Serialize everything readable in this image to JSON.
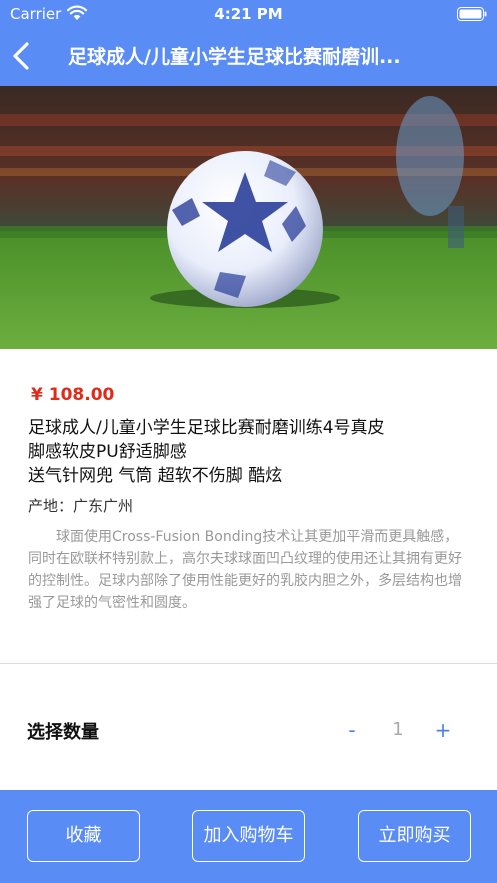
{
  "status_bar": {
    "carrier": "Carrier",
    "time": "4:21 PM"
  },
  "nav": {
    "title": "足球成人/儿童小学生足球比赛耐磨训...",
    "back_icon": "chevron-left-icon",
    "background_color": "#5a8cf6"
  },
  "product": {
    "price": "¥ 108.00",
    "name_lines": [
      "足球成人/儿童小学生足球比赛耐磨训练4号真皮",
      "脚感软皮PU舒适脚感",
      "送气针网兜 气筒 超软不伤脚 酷炫"
    ],
    "origin": "产地：广东广州",
    "description": "球面使用Cross-Fusion Bonding技术让其更加平滑而更具触感，同时在欧联杯特别款上，高尔夫球球面凹凸纹理的使用还让其拥有更好的控制性。足球内部除了使用性能更好的乳胶内胆之外，多层结构也增强了足球的气密性和圆度。",
    "price_color": "#e02a1a"
  },
  "quantity": {
    "label": "选择数量",
    "minus": "-",
    "value": "1",
    "plus": "+"
  },
  "actions": {
    "favorite": "收藏",
    "add_to_cart": "加入购物车",
    "buy_now": "立即购买"
  }
}
